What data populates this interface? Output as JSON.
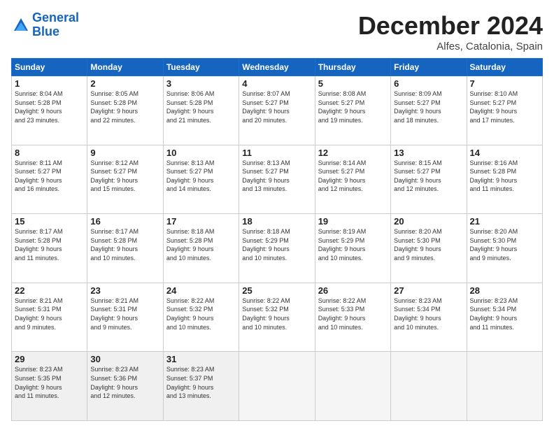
{
  "header": {
    "logo_line1": "General",
    "logo_line2": "Blue",
    "month": "December 2024",
    "location": "Alfes, Catalonia, Spain"
  },
  "weekdays": [
    "Sunday",
    "Monday",
    "Tuesday",
    "Wednesday",
    "Thursday",
    "Friday",
    "Saturday"
  ],
  "weeks": [
    [
      {
        "day": "1",
        "lines": [
          "Sunrise: 8:04 AM",
          "Sunset: 5:28 PM",
          "Daylight: 9 hours",
          "and 23 minutes."
        ]
      },
      {
        "day": "2",
        "lines": [
          "Sunrise: 8:05 AM",
          "Sunset: 5:28 PM",
          "Daylight: 9 hours",
          "and 22 minutes."
        ]
      },
      {
        "day": "3",
        "lines": [
          "Sunrise: 8:06 AM",
          "Sunset: 5:28 PM",
          "Daylight: 9 hours",
          "and 21 minutes."
        ]
      },
      {
        "day": "4",
        "lines": [
          "Sunrise: 8:07 AM",
          "Sunset: 5:27 PM",
          "Daylight: 9 hours",
          "and 20 minutes."
        ]
      },
      {
        "day": "5",
        "lines": [
          "Sunrise: 8:08 AM",
          "Sunset: 5:27 PM",
          "Daylight: 9 hours",
          "and 19 minutes."
        ]
      },
      {
        "day": "6",
        "lines": [
          "Sunrise: 8:09 AM",
          "Sunset: 5:27 PM",
          "Daylight: 9 hours",
          "and 18 minutes."
        ]
      },
      {
        "day": "7",
        "lines": [
          "Sunrise: 8:10 AM",
          "Sunset: 5:27 PM",
          "Daylight: 9 hours",
          "and 17 minutes."
        ]
      }
    ],
    [
      {
        "day": "8",
        "lines": [
          "Sunrise: 8:11 AM",
          "Sunset: 5:27 PM",
          "Daylight: 9 hours",
          "and 16 minutes."
        ]
      },
      {
        "day": "9",
        "lines": [
          "Sunrise: 8:12 AM",
          "Sunset: 5:27 PM",
          "Daylight: 9 hours",
          "and 15 minutes."
        ]
      },
      {
        "day": "10",
        "lines": [
          "Sunrise: 8:13 AM",
          "Sunset: 5:27 PM",
          "Daylight: 9 hours",
          "and 14 minutes."
        ]
      },
      {
        "day": "11",
        "lines": [
          "Sunrise: 8:13 AM",
          "Sunset: 5:27 PM",
          "Daylight: 9 hours",
          "and 13 minutes."
        ]
      },
      {
        "day": "12",
        "lines": [
          "Sunrise: 8:14 AM",
          "Sunset: 5:27 PM",
          "Daylight: 9 hours",
          "and 12 minutes."
        ]
      },
      {
        "day": "13",
        "lines": [
          "Sunrise: 8:15 AM",
          "Sunset: 5:27 PM",
          "Daylight: 9 hours",
          "and 12 minutes."
        ]
      },
      {
        "day": "14",
        "lines": [
          "Sunrise: 8:16 AM",
          "Sunset: 5:28 PM",
          "Daylight: 9 hours",
          "and 11 minutes."
        ]
      }
    ],
    [
      {
        "day": "15",
        "lines": [
          "Sunrise: 8:17 AM",
          "Sunset: 5:28 PM",
          "Daylight: 9 hours",
          "and 11 minutes."
        ]
      },
      {
        "day": "16",
        "lines": [
          "Sunrise: 8:17 AM",
          "Sunset: 5:28 PM",
          "Daylight: 9 hours",
          "and 10 minutes."
        ]
      },
      {
        "day": "17",
        "lines": [
          "Sunrise: 8:18 AM",
          "Sunset: 5:28 PM",
          "Daylight: 9 hours",
          "and 10 minutes."
        ]
      },
      {
        "day": "18",
        "lines": [
          "Sunrise: 8:18 AM",
          "Sunset: 5:29 PM",
          "Daylight: 9 hours",
          "and 10 minutes."
        ]
      },
      {
        "day": "19",
        "lines": [
          "Sunrise: 8:19 AM",
          "Sunset: 5:29 PM",
          "Daylight: 9 hours",
          "and 10 minutes."
        ]
      },
      {
        "day": "20",
        "lines": [
          "Sunrise: 8:20 AM",
          "Sunset: 5:30 PM",
          "Daylight: 9 hours",
          "and 9 minutes."
        ]
      },
      {
        "day": "21",
        "lines": [
          "Sunrise: 8:20 AM",
          "Sunset: 5:30 PM",
          "Daylight: 9 hours",
          "and 9 minutes."
        ]
      }
    ],
    [
      {
        "day": "22",
        "lines": [
          "Sunrise: 8:21 AM",
          "Sunset: 5:31 PM",
          "Daylight: 9 hours",
          "and 9 minutes."
        ]
      },
      {
        "day": "23",
        "lines": [
          "Sunrise: 8:21 AM",
          "Sunset: 5:31 PM",
          "Daylight: 9 hours",
          "and 9 minutes."
        ]
      },
      {
        "day": "24",
        "lines": [
          "Sunrise: 8:22 AM",
          "Sunset: 5:32 PM",
          "Daylight: 9 hours",
          "and 10 minutes."
        ]
      },
      {
        "day": "25",
        "lines": [
          "Sunrise: 8:22 AM",
          "Sunset: 5:32 PM",
          "Daylight: 9 hours",
          "and 10 minutes."
        ]
      },
      {
        "day": "26",
        "lines": [
          "Sunrise: 8:22 AM",
          "Sunset: 5:33 PM",
          "Daylight: 9 hours",
          "and 10 minutes."
        ]
      },
      {
        "day": "27",
        "lines": [
          "Sunrise: 8:23 AM",
          "Sunset: 5:34 PM",
          "Daylight: 9 hours",
          "and 10 minutes."
        ]
      },
      {
        "day": "28",
        "lines": [
          "Sunrise: 8:23 AM",
          "Sunset: 5:34 PM",
          "Daylight: 9 hours",
          "and 11 minutes."
        ]
      }
    ],
    [
      {
        "day": "29",
        "lines": [
          "Sunrise: 8:23 AM",
          "Sunset: 5:35 PM",
          "Daylight: 9 hours",
          "and 11 minutes."
        ]
      },
      {
        "day": "30",
        "lines": [
          "Sunrise: 8:23 AM",
          "Sunset: 5:36 PM",
          "Daylight: 9 hours",
          "and 12 minutes."
        ]
      },
      {
        "day": "31",
        "lines": [
          "Sunrise: 8:23 AM",
          "Sunset: 5:37 PM",
          "Daylight: 9 hours",
          "and 13 minutes."
        ]
      },
      null,
      null,
      null,
      null
    ]
  ]
}
